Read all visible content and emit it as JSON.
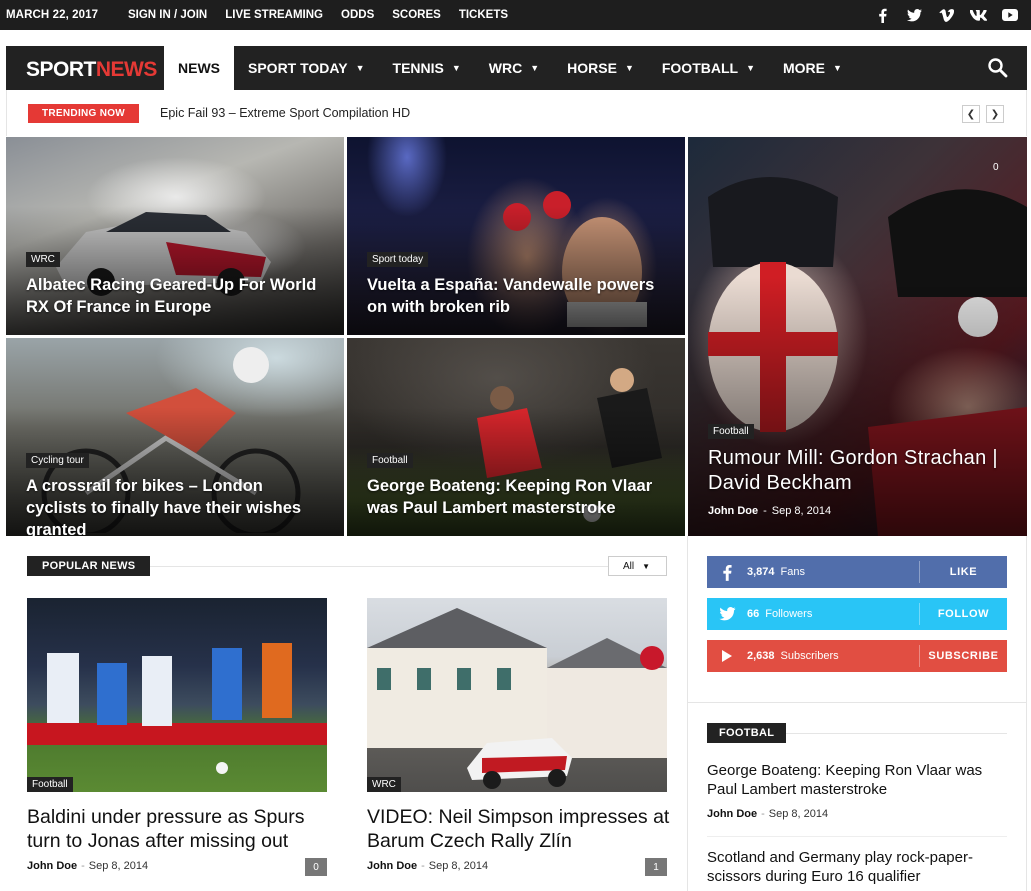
{
  "topbar": {
    "date": "MARCH 22, 2017",
    "links": [
      "SIGN IN / JOIN",
      "LIVE STREAMING",
      "ODDS",
      "SCORES",
      "TICKETS"
    ],
    "social_icons": [
      "facebook-icon",
      "twitter-icon",
      "vimeo-icon",
      "vk-icon",
      "youtube-icon"
    ]
  },
  "logo": {
    "part1": "SPORT",
    "part2": "NEWS"
  },
  "nav": {
    "items": [
      {
        "label": "NEWS",
        "active": true,
        "dropdown": false
      },
      {
        "label": "SPORT TODAY",
        "active": false,
        "dropdown": true
      },
      {
        "label": "TENNIS",
        "active": false,
        "dropdown": true
      },
      {
        "label": "WRC",
        "active": false,
        "dropdown": true
      },
      {
        "label": "HORSE",
        "active": false,
        "dropdown": true
      },
      {
        "label": "FOOTBALL",
        "active": false,
        "dropdown": true
      },
      {
        "label": "MORE",
        "active": false,
        "dropdown": true
      }
    ]
  },
  "trending": {
    "label": "TRENDING NOW",
    "text": "Epic Fail 93 – Extreme Sport Compilation HD"
  },
  "featured": [
    {
      "category": "WRC",
      "title": "Albatec Racing Geared-Up For World RX Of France in Europe"
    },
    {
      "category": "Sport today",
      "title": "Vuelta a España: Vandewalle powers on with broken rib"
    },
    {
      "category": "Cycling tour",
      "title": "A crossrail for bikes – London cyclists to finally have their wishes granted"
    },
    {
      "category": "Football",
      "title": "George Boateng: Keeping Ron Vlaar was Paul Lambert masterstroke"
    },
    {
      "category": "Football",
      "title": "Rumour Mill: Gordon Strachan | David Beckham",
      "author": "John Doe",
      "date": "Sep 8, 2014",
      "comments": "0"
    }
  ],
  "popular": {
    "heading": "POPULAR NEWS",
    "filter": "All",
    "cards": [
      {
        "category": "Football",
        "title": "Baldini under pressure as Spurs turn to Jonas after missing out",
        "author": "John Doe",
        "date": "Sep 8, 2014",
        "comments": "0"
      },
      {
        "category": "WRC",
        "title": "VIDEO: Neil Simpson impresses at Barum Czech Rally Zlín",
        "author": "John Doe",
        "date": "Sep 8, 2014",
        "comments": "1"
      }
    ]
  },
  "social": [
    {
      "icon": "facebook-icon",
      "count": "3,874",
      "label": "Fans",
      "action": "LIKE",
      "color": "#516eab"
    },
    {
      "icon": "twitter-icon",
      "count": "66",
      "label": "Followers",
      "action": "FOLLOW",
      "color": "#29c5f6"
    },
    {
      "icon": "youtube-icon",
      "count": "2,638",
      "label": "Subscribers",
      "action": "SUBSCRIBE",
      "color": "#e14e42"
    }
  ],
  "sidebar_block": {
    "heading": "FOOTBAL",
    "items": [
      {
        "title": "George Boateng: Keeping Ron Vlaar was Paul Lambert masterstroke",
        "author": "John Doe",
        "date": "Sep 8, 2014"
      },
      {
        "title": "Scotland and Germany play rock-paper-scissors during Euro 16 qualifier"
      }
    ]
  },
  "colors": {
    "accent": "#e53935",
    "dark": "#222222"
  }
}
